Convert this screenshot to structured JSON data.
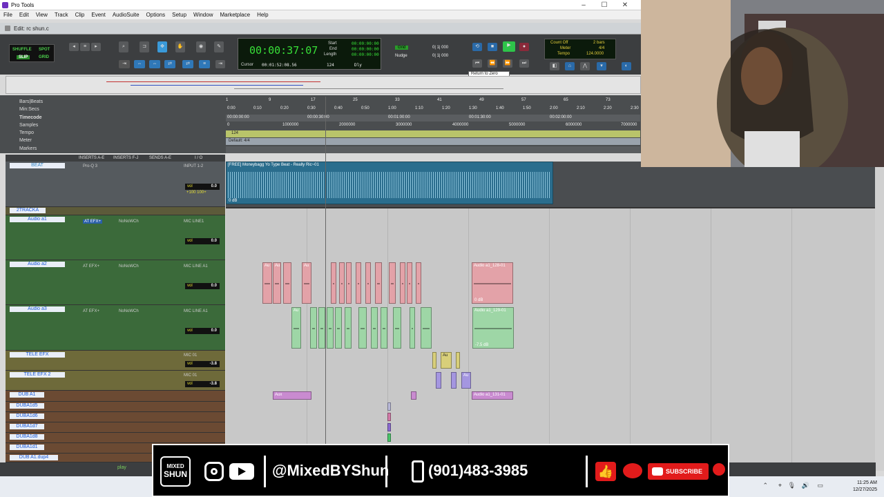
{
  "window": {
    "title": "Pro Tools",
    "edit_title": "Edit: rc shun.c"
  },
  "menu": [
    "File",
    "Edit",
    "View",
    "Track",
    "Clip",
    "Event",
    "AudioSuite",
    "Options",
    "Setup",
    "Window",
    "Marketplace",
    "Help"
  ],
  "modes": {
    "shuffle": "SHUFFLE",
    "spot": "SPOT",
    "slip": "SLIP",
    "grid": "GRID"
  },
  "counter": {
    "main": "00:00:37:07",
    "start_label": "Start",
    "end_label": "End",
    "length_label": "Length",
    "start": "00:00:00:00",
    "end": "00:00:00:00",
    "length": "00:00:00:00",
    "cursor_label": "Cursor",
    "cursor": "00:01:52:08.56",
    "tempo_val": "124",
    "dly": "Dly"
  },
  "grid": {
    "grid_label": "Grid",
    "grid_val": "0| 1| 000",
    "nudge_label": "Nudge",
    "nudge_val": "0| 1| 000"
  },
  "tempo": {
    "count_off": "Count Off",
    "bars": "2 bars",
    "meter": "Meter",
    "meter_val": "4/4",
    "tempo_label": "Tempo",
    "tempo_val": "124.0000"
  },
  "tooltip": "Return to Zero",
  "rulers": {
    "labels": [
      "Bars|Beats",
      "Min:Secs",
      "Timecode",
      "Samples",
      "Tempo",
      "Meter",
      "Markers"
    ],
    "bars": [
      "1",
      "9",
      "17",
      "25",
      "33",
      "41",
      "49",
      "57",
      "65",
      "73"
    ],
    "minsecs": [
      "0:00",
      "0:10",
      "0:20",
      "0:30",
      "0:40",
      "0:50",
      "1:00",
      "1:10",
      "1:20",
      "1:30",
      "1:40",
      "1:50",
      "2:00",
      "2:10",
      "2:20",
      "2:30"
    ],
    "timecode": [
      "00:00:00:00",
      "00:00:30:00",
      "00:01:00:00",
      "00:01:30:00",
      "00:02:00:00"
    ],
    "samples": [
      "0",
      "1000000",
      "2000000",
      "3000000",
      "4000000",
      "5000000",
      "6000000",
      "7000000"
    ],
    "tempo_marker": "124",
    "meter_marker": "Default: 4/4"
  },
  "mix_header": {
    "inserts_ae": "INSERTS A-E",
    "inserts_fj": "INSERTS F-J",
    "sends": "SENDS A-E",
    "io": "I / O"
  },
  "tracks": [
    {
      "name": "BEAT",
      "color": "#3a8ac7",
      "vol": "0.0",
      "pan": "+100 100+",
      "insert": "Pro-Q 3",
      "io": "INPUT 1-2"
    },
    {
      "name": "2TRACKA",
      "color": "#f0d040",
      "vol": "",
      "pan": "",
      "insert": "",
      "io": ""
    },
    {
      "name": "Audio a1",
      "color": "#5cc45c",
      "vol": "0.0",
      "insert": "AT EFX+",
      "insert2": "NoNoWCh",
      "io": "MIC LINE1"
    },
    {
      "name": "Audio a2",
      "color": "#5cc45c",
      "vol": "0.0",
      "insert": "AT EFX+",
      "insert2": "NoNoWCh",
      "io": "MIC LINE A1"
    },
    {
      "name": "Audio a3",
      "color": "#5cc45c",
      "vol": "0.0",
      "insert": "AT EFX+",
      "insert2": "NoNoWCh",
      "io": "MIC LINE A1"
    },
    {
      "name": "TELE EFX",
      "color": "#d6c94e",
      "vol": "-3.8",
      "io": "MIC 01"
    },
    {
      "name": "TELE EFX 2",
      "color": "#d6c94e",
      "vol": "-3.8",
      "io": "MIC 01"
    },
    {
      "name": "DUB A1",
      "color": "#e07030"
    },
    {
      "name": "DUBA1d5",
      "color": "#e07030"
    },
    {
      "name": "DUBA1d6",
      "color": "#e07030"
    },
    {
      "name": "DUBA1d7",
      "color": "#e07030"
    },
    {
      "name": "DUBA1d8",
      "color": "#e07030"
    },
    {
      "name": "DUBA1d1",
      "color": "#e07030"
    },
    {
      "name": "DUB A1.dup4",
      "color": "#e07030"
    }
  ],
  "clips": {
    "beat": {
      "name": "[FREE] Moneybagg Yo Type Beat - Really Ric~01",
      "db": "0 dB"
    },
    "a2_main": {
      "name": "Audio a1_128-01",
      "db": "0 dB"
    },
    "a3_main": {
      "name": "Audio a1_129-01",
      "db": "-7.5 dB"
    },
    "dub_main": {
      "name": "Audio a1_131-01"
    },
    "short": "Au",
    "short2": "Aux"
  },
  "transport_status": "play",
  "banner": {
    "logo_top": "MIXED",
    "logo_bottom": "SHUN",
    "handle": "@MixedBYShun",
    "phone": "(901)483-3985",
    "subscribe": "SUBSCRIBE"
  },
  "clock": {
    "time": "11:25 AM",
    "date": "12/27/2025"
  }
}
